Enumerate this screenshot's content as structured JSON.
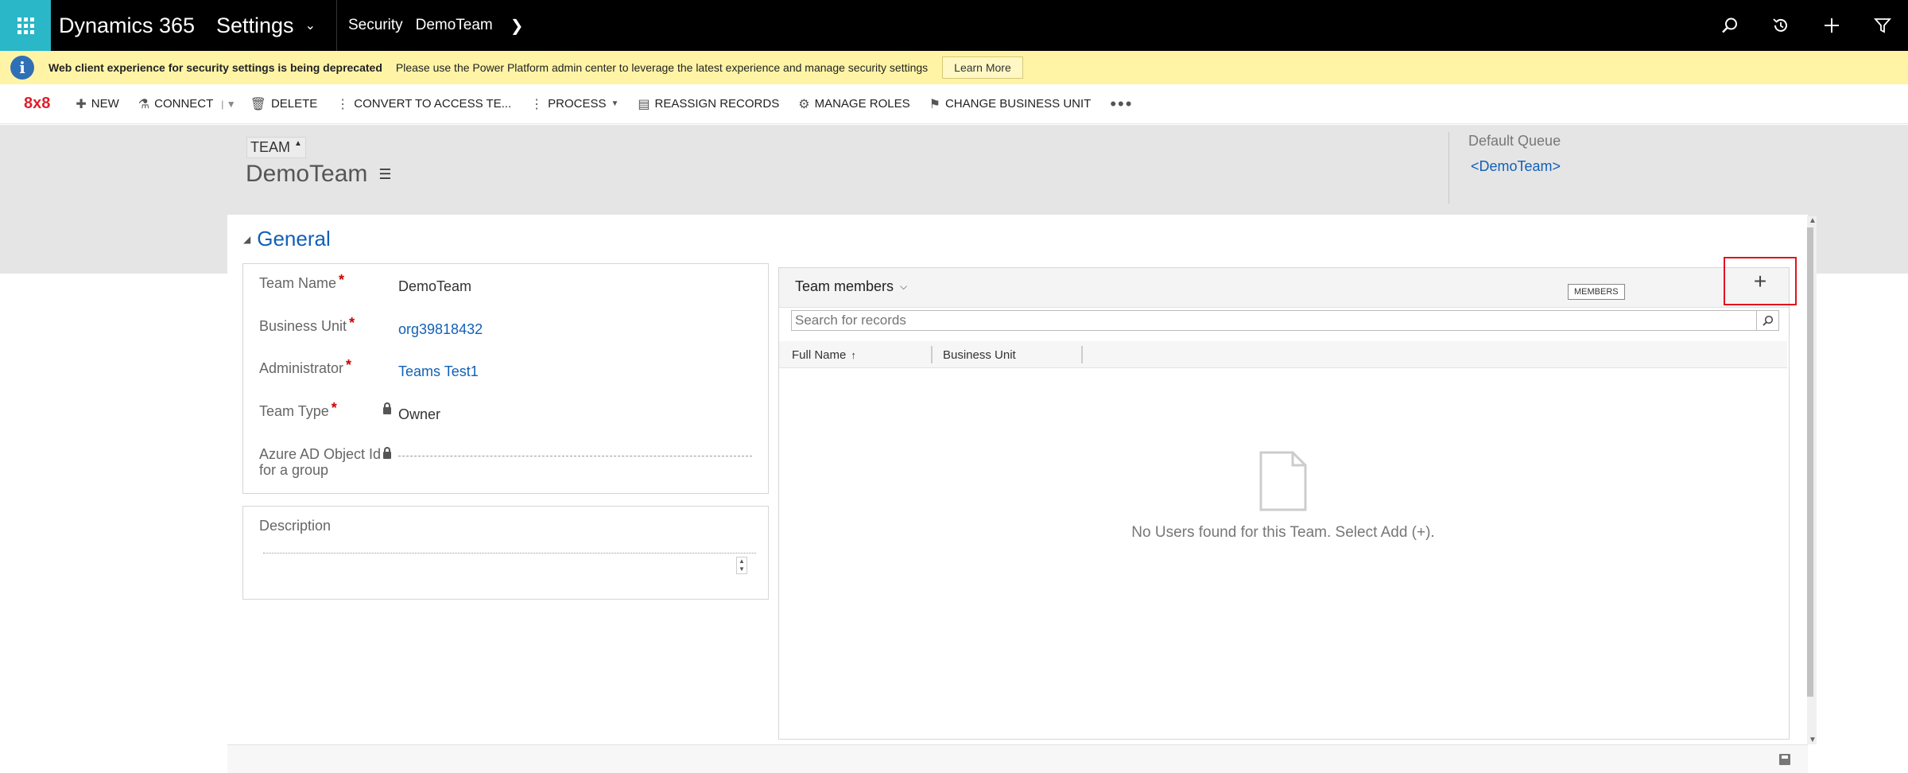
{
  "topnav": {
    "app_name": "Dynamics 365",
    "area": "Settings",
    "breadcrumb": [
      "Security",
      "DemoTeam"
    ],
    "icons": [
      "search-icon",
      "history-icon",
      "add-icon",
      "filter-icon"
    ]
  },
  "banner": {
    "bold_text": "Web client experience for security settings is being deprecated",
    "text": "Please use the Power Platform admin center to leverage the latest experience and manage security settings",
    "button": "Learn More"
  },
  "commandbar": {
    "logo": "8x8",
    "items": [
      "NEW",
      "CONNECT",
      "DELETE",
      "CONVERT TO ACCESS TE...",
      "PROCESS",
      "REASSIGN RECORDS",
      "MANAGE ROLES",
      "CHANGE BUSINESS UNIT"
    ],
    "more": "•••"
  },
  "header": {
    "entity_type": "TEAM",
    "record_name": "DemoTeam",
    "default_queue_label": "Default Queue",
    "default_queue_value": "<DemoTeam>"
  },
  "form": {
    "section_title": "General",
    "fields": [
      {
        "label": "Team Name",
        "value": "DemoTeam",
        "required": "*"
      },
      {
        "label": "Business Unit",
        "value": "org39818432",
        "required": "*"
      },
      {
        "label": "Administrator",
        "value": "Teams Test1",
        "required": "*"
      },
      {
        "label": "Team Type",
        "value": "Owner",
        "required": "*"
      },
      {
        "label_line1": "Azure AD Object Id",
        "label_line2": "for a group",
        "value": ""
      }
    ],
    "description_label": "Description"
  },
  "subgrid": {
    "title": "Team members",
    "tooltip": "MEMBERS",
    "add_symbol": "+",
    "search_placeholder": "Search for records",
    "columns": [
      "Full Name",
      "Business Unit"
    ],
    "empty_message": "No Users found for this Team. Select Add (+)."
  },
  "colors": {
    "accent": "#2ab7c7",
    "link": "#1160b7",
    "banner_bg": "#fff4a6",
    "highlight": "#e0141e"
  }
}
